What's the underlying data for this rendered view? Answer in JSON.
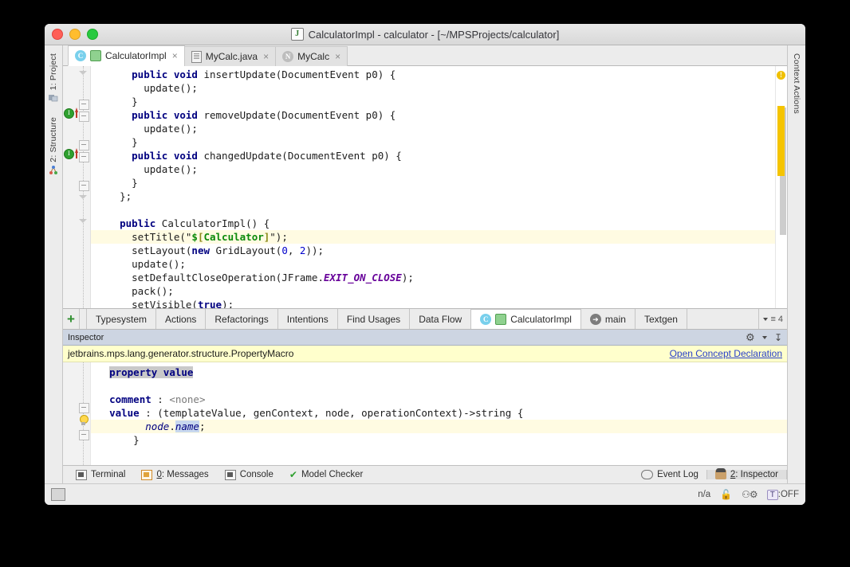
{
  "window": {
    "title": "CalculatorImpl - calculator - [~/MPSProjects/calculator]",
    "app_badge": "J"
  },
  "left_strip": {
    "items": [
      {
        "label": "1: Project",
        "icon": "project-icon"
      },
      {
        "label": "2: Structure",
        "icon": "structure-icon"
      }
    ]
  },
  "right_strip": {
    "items": [
      {
        "label": "Context Actions",
        "icon": "context-actions-icon"
      }
    ]
  },
  "editor_tabs": [
    {
      "label": "CalculatorImpl",
      "active": true,
      "icons": [
        "class-circle-icon",
        "node-icon"
      ],
      "close": "×"
    },
    {
      "label": "MyCalc.java",
      "active": false,
      "icons": [
        "java-file-icon"
      ],
      "close": "×"
    },
    {
      "label": "MyCalc",
      "active": false,
      "icons": [
        "node-grey-icon"
      ],
      "close": "×"
    }
  ],
  "editor": {
    "warning_badge": "!",
    "lines": [
      {
        "indent": 6,
        "hl": false,
        "tokens": [
          {
            "t": "public",
            "c": "kw"
          },
          {
            "t": " ",
            "c": "id"
          },
          {
            "t": "void",
            "c": "kw"
          },
          {
            "t": " insertUpdate(DocumentEvent p0) {",
            "c": "id"
          }
        ]
      },
      {
        "indent": 8,
        "hl": false,
        "tokens": [
          {
            "t": "update();",
            "c": "id"
          }
        ]
      },
      {
        "indent": 6,
        "hl": false,
        "tokens": [
          {
            "t": "}",
            "c": "id"
          }
        ]
      },
      {
        "indent": 6,
        "hl": false,
        "tokens": [
          {
            "t": "public",
            "c": "kw"
          },
          {
            "t": " ",
            "c": "id"
          },
          {
            "t": "void",
            "c": "kw"
          },
          {
            "t": " removeUpdate(DocumentEvent p0) {",
            "c": "id"
          }
        ]
      },
      {
        "indent": 8,
        "hl": false,
        "tokens": [
          {
            "t": "update();",
            "c": "id"
          }
        ]
      },
      {
        "indent": 6,
        "hl": false,
        "tokens": [
          {
            "t": "}",
            "c": "id"
          }
        ]
      },
      {
        "indent": 6,
        "hl": false,
        "tokens": [
          {
            "t": "public",
            "c": "kw"
          },
          {
            "t": " ",
            "c": "id"
          },
          {
            "t": "void",
            "c": "kw"
          },
          {
            "t": " changedUpdate(DocumentEvent p0) {",
            "c": "id"
          }
        ]
      },
      {
        "indent": 8,
        "hl": false,
        "tokens": [
          {
            "t": "update();",
            "c": "id"
          }
        ]
      },
      {
        "indent": 6,
        "hl": false,
        "tokens": [
          {
            "t": "}",
            "c": "id"
          }
        ]
      },
      {
        "indent": 4,
        "hl": false,
        "tokens": [
          {
            "t": "};",
            "c": "id"
          }
        ]
      },
      {
        "indent": 0,
        "hl": false,
        "tokens": [
          {
            "t": "",
            "c": "id"
          }
        ]
      },
      {
        "indent": 4,
        "hl": false,
        "tokens": [
          {
            "t": "public",
            "c": "kw"
          },
          {
            "t": " CalculatorImpl() {",
            "c": "id"
          }
        ]
      },
      {
        "indent": 6,
        "hl": true,
        "tokens": [
          {
            "t": "setTitle(\"",
            "c": "id"
          },
          {
            "t": "$",
            "c": "mac"
          },
          {
            "t": "[",
            "c": "macbr"
          },
          {
            "t": "Calculator",
            "c": "mac"
          },
          {
            "t": "]",
            "c": "macbr"
          },
          {
            "t": "\");",
            "c": "id"
          }
        ]
      },
      {
        "indent": 6,
        "hl": false,
        "tokens": [
          {
            "t": "setLayout(",
            "c": "id"
          },
          {
            "t": "new",
            "c": "kw"
          },
          {
            "t": " GridLayout(",
            "c": "id"
          },
          {
            "t": "0",
            "c": "num"
          },
          {
            "t": ", ",
            "c": "id"
          },
          {
            "t": "2",
            "c": "num"
          },
          {
            "t": "));",
            "c": "id"
          }
        ]
      },
      {
        "indent": 6,
        "hl": false,
        "tokens": [
          {
            "t": "update();",
            "c": "id"
          }
        ]
      },
      {
        "indent": 6,
        "hl": false,
        "tokens": [
          {
            "t": "setDefaultCloseOperation(JFrame.",
            "c": "id"
          },
          {
            "t": "EXIT_ON_CLOSE",
            "c": "stat"
          },
          {
            "t": ");",
            "c": "id"
          }
        ]
      },
      {
        "indent": 6,
        "hl": false,
        "tokens": [
          {
            "t": "pack();",
            "c": "id"
          }
        ]
      },
      {
        "indent": 6,
        "hl": false,
        "tokens": [
          {
            "t": "setVisible(",
            "c": "id"
          },
          {
            "t": "true",
            "c": "kw"
          },
          {
            "t": ");",
            "c": "id"
          }
        ]
      }
    ]
  },
  "tool_tabs": {
    "add_label": "+",
    "items": [
      {
        "label": "Typesystem",
        "active": false,
        "icons": []
      },
      {
        "label": "Actions",
        "active": false,
        "icons": []
      },
      {
        "label": "Refactorings",
        "active": false,
        "icons": []
      },
      {
        "label": "Intentions",
        "active": false,
        "icons": []
      },
      {
        "label": "Find Usages",
        "active": false,
        "icons": []
      },
      {
        "label": "Data Flow",
        "active": false,
        "icons": []
      },
      {
        "label": "CalculatorImpl",
        "active": true,
        "icons": [
          "class-circle-icon",
          "node-icon"
        ]
      },
      {
        "label": "main",
        "active": false,
        "icons": [
          "arrow-circle-icon"
        ]
      },
      {
        "label": "Textgen",
        "active": false,
        "icons": []
      }
    ],
    "overflow_count": "4"
  },
  "inspector": {
    "header_title": "Inspector",
    "concept_path": "jetbrains.mps.lang.generator.structure.PropertyMacro",
    "open_concept_link": "Open Concept Declaration",
    "lines": [
      {
        "indent": 2,
        "hl": false,
        "tokens": [
          {
            "t": "property value",
            "c": "bold-dark selbox"
          }
        ]
      },
      {
        "indent": 0,
        "hl": false,
        "tokens": [
          {
            "t": "",
            "c": "id"
          }
        ]
      },
      {
        "indent": 2,
        "hl": false,
        "tokens": [
          {
            "t": "comment",
            "c": "bold-dark"
          },
          {
            "t": " : ",
            "c": "id"
          },
          {
            "t": "<none>",
            "c": "grey-it"
          }
        ]
      },
      {
        "indent": 2,
        "hl": false,
        "tokens": [
          {
            "t": "value",
            "c": "bold-dark"
          },
          {
            "t": " : ",
            "c": "id"
          },
          {
            "t": "(templateValue, genContext, node, operationContext)->string {",
            "c": "id"
          }
        ]
      },
      {
        "indent": 8,
        "hl": true,
        "tokens": [
          {
            "t": "node",
            "c": "it-blue"
          },
          {
            "t": ".",
            "c": "id"
          },
          {
            "t": "name",
            "c": "it-blue sel"
          },
          {
            "t": ";",
            "c": "id"
          }
        ]
      },
      {
        "indent": 6,
        "hl": false,
        "tokens": [
          {
            "t": "}",
            "c": "id"
          }
        ]
      }
    ]
  },
  "status_bar": {
    "left_items": [
      {
        "label": "Terminal",
        "icon": "terminal-icon"
      },
      {
        "label": "0: Messages",
        "icon": "messages-icon",
        "mnemonic": "0"
      },
      {
        "label": "Console",
        "icon": "console-icon"
      },
      {
        "label": "Model Checker",
        "icon": "model-checker-icon"
      }
    ],
    "right_items": [
      {
        "label": "Event Log",
        "icon": "event-log-icon",
        "active": false
      },
      {
        "label": "2: Inspector",
        "icon": "inspector-icon",
        "active": true
      }
    ]
  },
  "bottom_bar": {
    "status_text": "n/a",
    "lock_icon": "lock-icon",
    "plug_icon": "plug-icon",
    "toggle_label": ":OFF",
    "toggle_key": "T"
  },
  "colors": {
    "accent_yellow": "#f5c400",
    "highlight_line": "#fffbe2",
    "concept_bg": "#ffffcc",
    "link_blue": "#2a40c8",
    "inspector_header": "#cdd5e2"
  }
}
